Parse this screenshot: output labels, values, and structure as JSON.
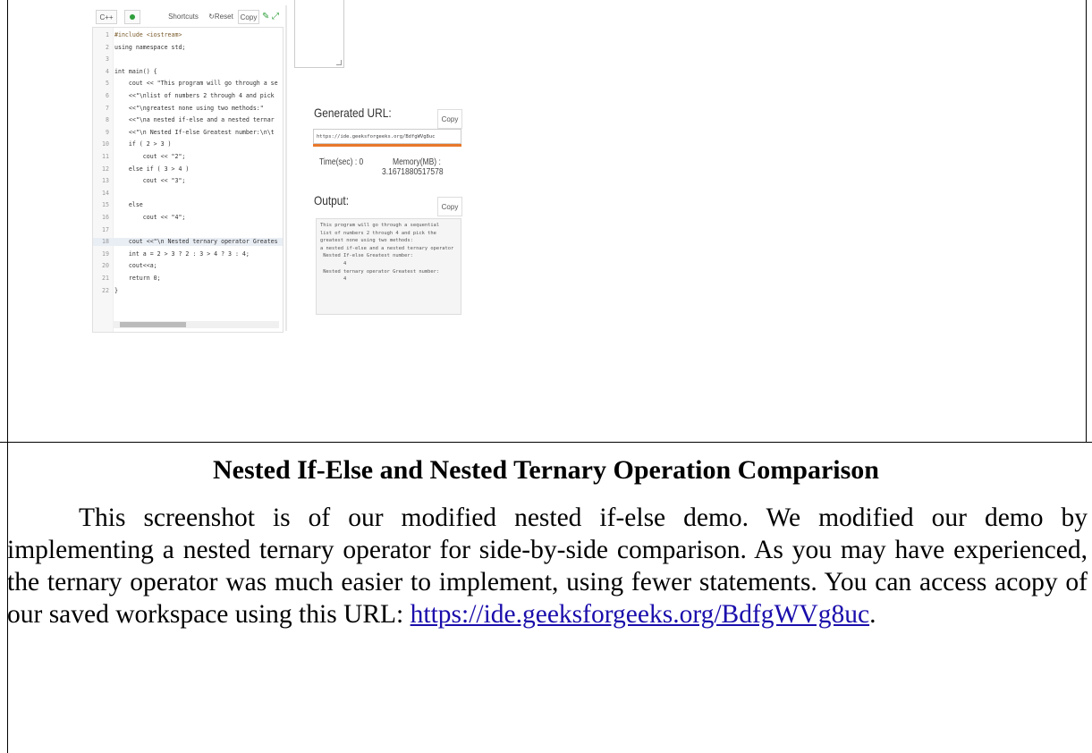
{
  "editor": {
    "language": "C++",
    "toolbar": {
      "shortcuts": "Shortcuts",
      "reset": "Reset",
      "copy": "Copy"
    },
    "lines": [
      {
        "n": "1",
        "code": "#include <iostream>"
      },
      {
        "n": "2",
        "code": "using namespace std;"
      },
      {
        "n": "3",
        "code": ""
      },
      {
        "n": "4",
        "code": "int main() {"
      },
      {
        "n": "5",
        "code": "    cout << \"This program will go through a se"
      },
      {
        "n": "6",
        "code": "    <<\"\\nlist of numbers 2 through 4 and pick"
      },
      {
        "n": "7",
        "code": "    <<\"\\ngreatest none using two methods:\""
      },
      {
        "n": "8",
        "code": "    <<\"\\na nested if-else and a nested ternar"
      },
      {
        "n": "9",
        "code": "    <<\"\\n Nested If-else Greatest number:\\n\\t"
      },
      {
        "n": "10",
        "code": "    if ( 2 > 3 )"
      },
      {
        "n": "11",
        "code": "        cout << \"2\";"
      },
      {
        "n": "12",
        "code": "    else if ( 3 > 4 )"
      },
      {
        "n": "13",
        "code": "        cout << \"3\";"
      },
      {
        "n": "14",
        "code": ""
      },
      {
        "n": "15",
        "code": "    else"
      },
      {
        "n": "16",
        "code": "        cout << \"4\";"
      },
      {
        "n": "17",
        "code": ""
      },
      {
        "n": "18",
        "code": "    cout <<\"\\n Nested ternary operator Greates"
      },
      {
        "n": "19",
        "code": "    int a = 2 > 3 ? 2 : 3 > 4 ? 3 : 4;"
      },
      {
        "n": "20",
        "code": "    cout<<a;"
      },
      {
        "n": "21",
        "code": "    return 0;"
      },
      {
        "n": "22",
        "code": "}"
      }
    ]
  },
  "output_panel": {
    "generated_url_label": "Generated URL:",
    "copy_label": "Copy",
    "url_value": "https://ide.geeksforgeeks.org/BdfgWVg8uc",
    "time_label": "Time(sec) : 0",
    "memory_label": "Memory(MB) :",
    "memory_value": "3.1671880517578",
    "output_label": "Output:",
    "output_text": "This program will go through a sequential\nlist of numbers 2 through 4 and pick the\ngreatest none using two methods:\na nested if-else and a nested ternary operator\n Nested If-else Greatest number:\n        4\n Nested ternary operator Greatest number:\n        4"
  },
  "document": {
    "caption": "Nested If-Else and Nested Ternary Operation Comparison",
    "paragraph_before_link": "This screenshot is of our modified nested if-else demo. We modified our demo by implementing a nested ternary operator for side-by-side comparison. As you may have experienced, the ternary operator was much easier to implement, using fewer statements. You can access acopy of our saved workspace using this URL: ",
    "link_text": "https://ide.geeksforgeeks.org/BdfgWVg8uc",
    "paragraph_after_link": "."
  }
}
